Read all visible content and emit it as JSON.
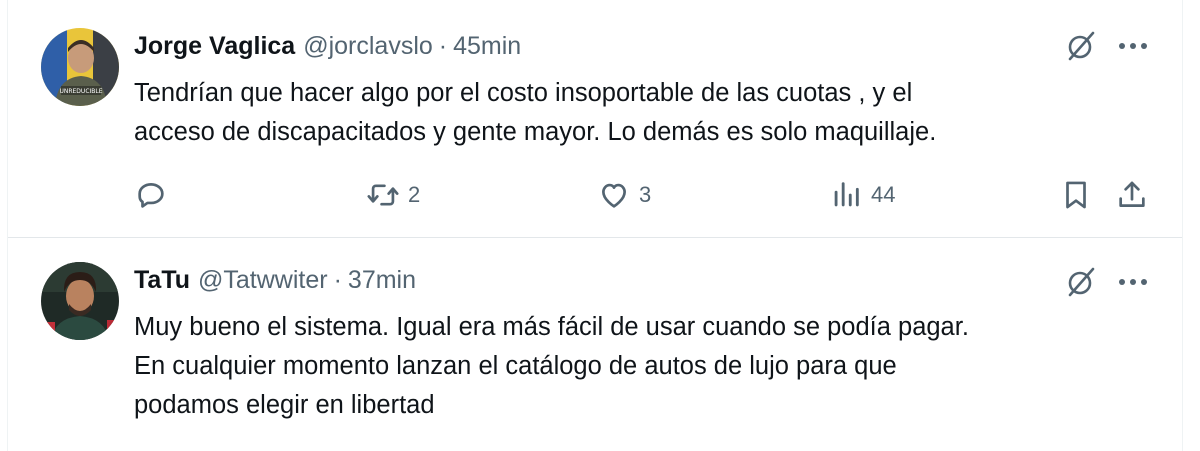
{
  "tweets": [
    {
      "name": "Jorge Vaglica",
      "handle": "@jorclavslo",
      "separator": "·",
      "time": "45min",
      "text_lines": [
        "Tendrían que hacer algo por el costo insoportable de las cuotas , y el",
        "acceso de discapacitados y gente mayor. Lo demás es solo maquillaje."
      ],
      "avatar_text": "UNREDUCIBLE",
      "counts": {
        "reply": "",
        "retweet": "2",
        "like": "3",
        "views": "44"
      }
    },
    {
      "name": "TaTu",
      "handle": "@Tatwwiter",
      "separator": "·",
      "time": "37min",
      "text_lines": [
        "Muy bueno el sistema. Igual era más fácil de usar cuando se podía pagar.",
        "En cualquier momento lanzan el catálogo de autos de lujo para que",
        "podamos elegir en libertad"
      ]
    }
  ],
  "icons": {
    "grok": "grok-icon",
    "more": "more-icon",
    "reply": "reply-icon",
    "retweet": "retweet-icon",
    "like": "heart-icon",
    "views": "views-icon",
    "bookmark": "bookmark-icon",
    "share": "share-icon"
  },
  "colors": {
    "text": "#0f1419",
    "secondary": "#536471",
    "divider": "#e3e7ea"
  }
}
